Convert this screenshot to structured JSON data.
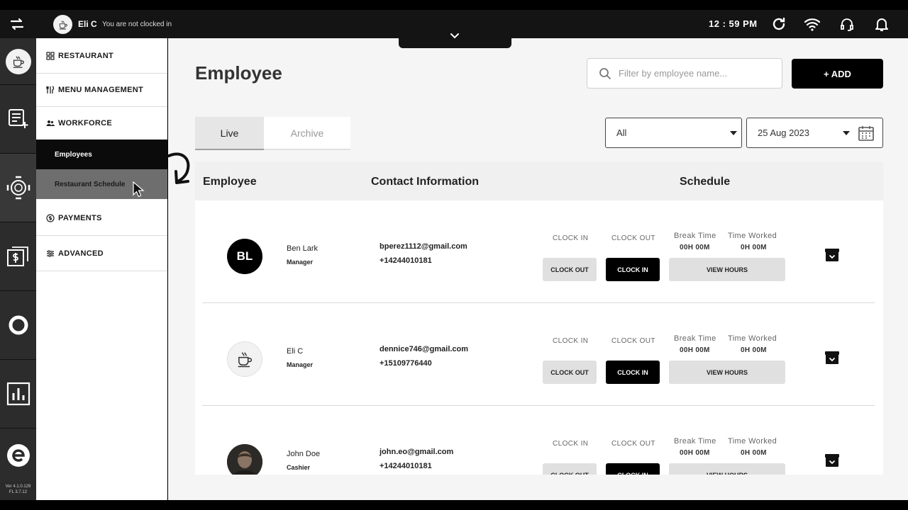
{
  "topbar": {
    "user_name": "Eli C",
    "user_status": "You are not clocked in",
    "time": "12 : 59 PM"
  },
  "rail": {
    "items": [
      {
        "icon": "coffee-logo-icon"
      },
      {
        "icon": "add-order-icon"
      },
      {
        "icon": "table-icon"
      },
      {
        "icon": "cash-icon"
      },
      {
        "icon": "ring-icon"
      },
      {
        "icon": "chart-icon"
      },
      {
        "icon": "e-logo-icon"
      }
    ],
    "version_line1": "Ver 4.1.0.129",
    "version_line2": "FL 3.7.12"
  },
  "sidemenu": {
    "restaurant": "RESTAURANT",
    "menu_management": "MENU MANAGEMENT",
    "workforce": "WORKFORCE",
    "employees": "Employees",
    "restaurant_schedule": "Restaurant Schedule",
    "payments": "PAYMENTS",
    "advanced": "ADVANCED"
  },
  "main": {
    "title": "Employee",
    "search_placeholder": "Filter by employee name...",
    "add_label": "+ ADD",
    "tabs": {
      "live": "Live",
      "archive": "Archive"
    },
    "filter_value": "All",
    "date_value": "25 Aug 2023",
    "headers": {
      "employee": "Employee",
      "contact": "Contact Information",
      "schedule": "Schedule"
    },
    "labels": {
      "clock_in": "CLOCK IN",
      "clock_out": "CLOCK OUT",
      "break_time": "Break Time",
      "time_worked": "Time Worked",
      "btn_clock_out": "CLOCK OUT",
      "btn_clock_in": "CLOCK IN",
      "btn_view_hours": "VIEW HOURS"
    },
    "employees": [
      {
        "initials": "BL",
        "name": "Ben Lark",
        "role": "Manager",
        "email": "bperez1112@gmail.com",
        "phone": "+14244010181",
        "break_time": "00H 00M",
        "time_worked": "0H 00M"
      },
      {
        "initials": "",
        "name": "Eli C",
        "role": "Manager",
        "email": "dennice746@gmail.com",
        "phone": "+15109776440",
        "break_time": "00H 00M",
        "time_worked": "0H 00M"
      },
      {
        "initials": "",
        "name": "John Doe",
        "role": "Cashier",
        "email": "john.eo@gmail.com",
        "phone": "+14244010181",
        "break_time": "00H 00M",
        "time_worked": "0H 00M"
      }
    ]
  },
  "colors": {
    "accent": "#000000",
    "menu_active": "#0b0b0b",
    "rail": "#2a2a2a"
  }
}
